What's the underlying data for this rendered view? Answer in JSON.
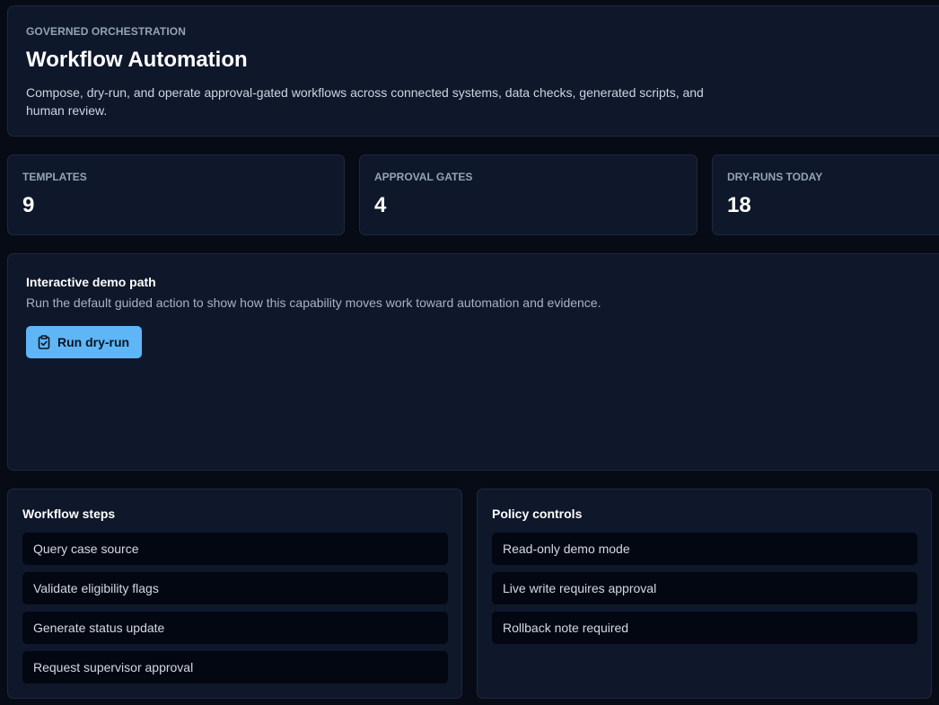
{
  "header": {
    "eyebrow": "GOVERNED ORCHESTRATION",
    "title": "Workflow Automation",
    "description": "Compose, dry-run, and operate approval-gated workflows across connected systems, data checks, generated scripts, and human review."
  },
  "stats": [
    {
      "label": "TEMPLATES",
      "value": "9"
    },
    {
      "label": "APPROVAL GATES",
      "value": "4"
    },
    {
      "label": "DRY-RUNS TODAY",
      "value": "18"
    }
  ],
  "demo": {
    "title": "Interactive demo path",
    "description": "Run the default guided action to show how this capability moves work toward automation and evidence.",
    "button_label": "Run dry-run",
    "button_icon": "clipboard-check-icon",
    "button_color": "#5fb6f6"
  },
  "workflow": {
    "title": "Workflow steps",
    "items": [
      "Query case source",
      "Validate eligibility flags",
      "Generate status update",
      "Request supervisor approval"
    ]
  },
  "policy": {
    "title": "Policy controls",
    "items": [
      "Read-only demo mode",
      "Live write requires approval",
      "Rollback note required"
    ]
  }
}
